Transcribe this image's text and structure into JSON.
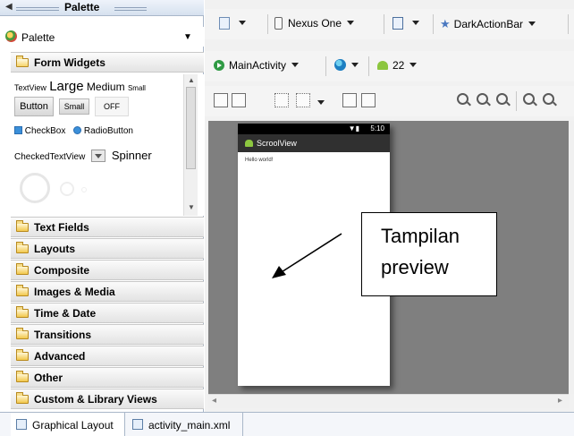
{
  "palette_panel": {
    "title": "Palette",
    "dropdown_label": "Palette",
    "open_category": "Form Widgets",
    "widgets": {
      "textview": "TextView",
      "large": "Large",
      "medium": "Medium",
      "small": "Small",
      "button": "Button",
      "small_button": "Small",
      "toggle_off": "OFF",
      "checkbox": "CheckBox",
      "radiobutton": "RadioButton",
      "checked_textview": "CheckedTextView",
      "spinner": "Spinner"
    },
    "categories": [
      "Text Fields",
      "Layouts",
      "Composite",
      "Images & Media",
      "Time & Date",
      "Transitions",
      "Advanced",
      "Other",
      "Custom & Library Views"
    ]
  },
  "toolbar1": {
    "device": "Nexus One",
    "theme": "DarkActionBar",
    "icons": [
      "config-icon",
      "phone-icon",
      "rotate-icon",
      "star-icon"
    ]
  },
  "toolbar2": {
    "activity": "MainActivity",
    "api_level": "22",
    "icons": [
      "activity-icon",
      "globe-icon",
      "android-icon"
    ]
  },
  "toolbar3": {
    "icons": [
      "fill-width-icon",
      "fill-height-icon",
      "grid-icon",
      "layout-icon",
      "margin-icon",
      "snap-icon",
      "zoom-out-icon",
      "zoom-fit-icon",
      "zoom-real-icon",
      "zoom-out2-icon",
      "zoom-in-icon"
    ]
  },
  "preview": {
    "status_time": "5:10",
    "app_title": "ScroolView",
    "hello_text": "Hello world!"
  },
  "callout": {
    "line1": "Tampilan",
    "line2": "preview"
  },
  "bottom_tabs": [
    "Graphical Layout",
    "activity_main.xml"
  ],
  "colors": {
    "panel_border": "#a9b7c9",
    "canvas_bg": "#7f7f7f",
    "actionbar": "#303030"
  }
}
